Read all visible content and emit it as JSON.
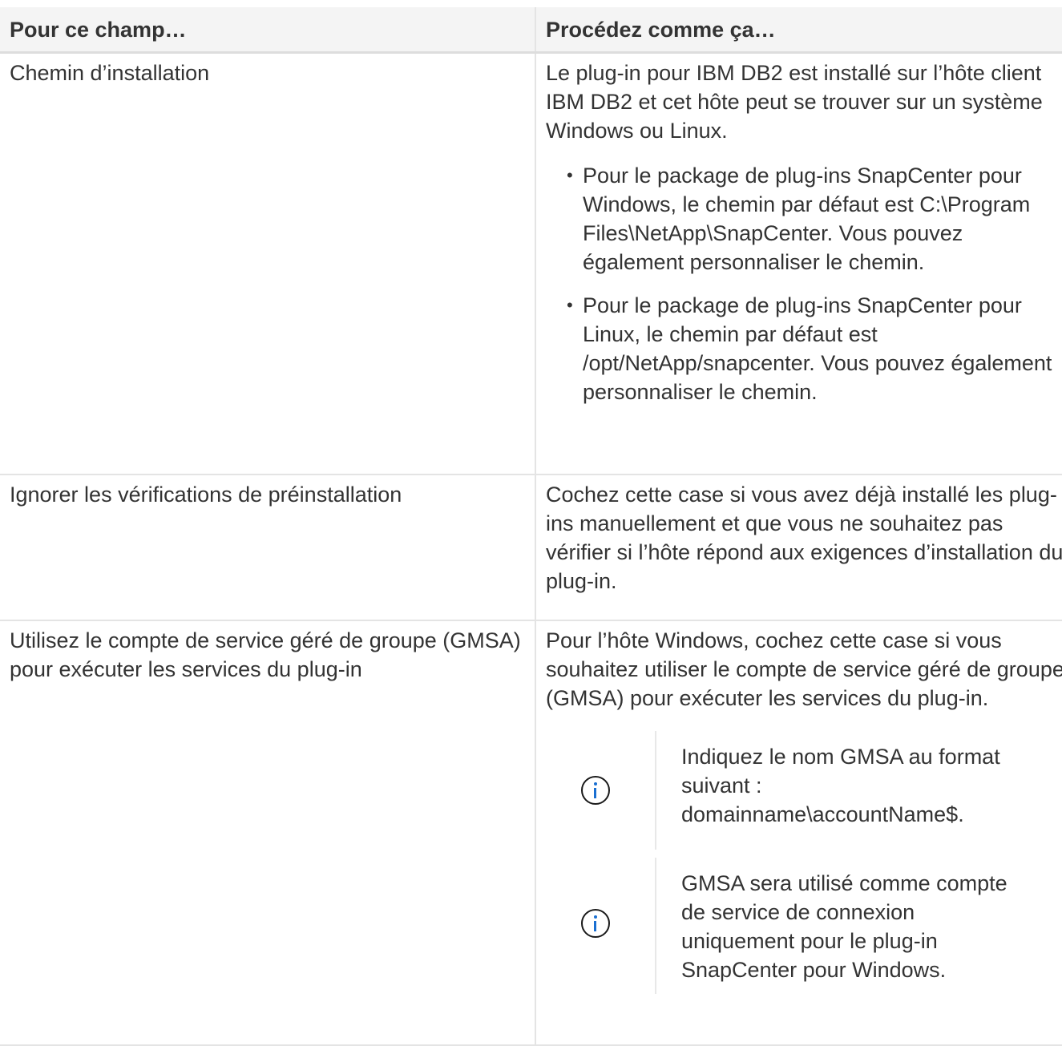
{
  "table": {
    "headers": [
      "Pour ce champ…",
      "Procédez comme ça…"
    ],
    "rows": [
      {
        "field": "Chemin d’installation",
        "description": "Le plug-in pour IBM DB2 est installé sur l’hôte client IBM DB2 et cet hôte peut se trouver sur un système Windows ou Linux.",
        "bullets": [
          "Pour le package de plug-ins SnapCenter pour Windows, le chemin par défaut est C:\\Program Files\\NetApp\\SnapCenter. Vous pouvez également personnaliser le chemin.",
          "Pour le package de plug-ins SnapCenter pour Linux, le chemin par défaut est /opt/NetApp/snapcenter. Vous pouvez également personnaliser le chemin."
        ]
      },
      {
        "field": "Ignorer les vérifications de préinstallation",
        "description": "Cochez cette case si vous avez déjà installé les plug-ins manuellement et que vous ne souhaitez pas vérifier si l’hôte répond aux exigences d’installation du plug-in."
      },
      {
        "field": "Utilisez le compte de service géré de groupe (GMSA) pour exécuter les services du plug-in",
        "description": "Pour l’hôte Windows, cochez cette case si vous souhaitez utiliser le compte de service géré de groupe (GMSA) pour exécuter les services du plug-in.",
        "notes": [
          {
            "icon": "info-icon",
            "text": "Indiquez le nom GMSA au format suivant : domainname\\accountName$."
          },
          {
            "icon": "info-icon",
            "text": "GMSA sera utilisé comme compte de service de connexion uniquement pour le plug-in SnapCenter pour Windows."
          }
        ]
      }
    ]
  }
}
